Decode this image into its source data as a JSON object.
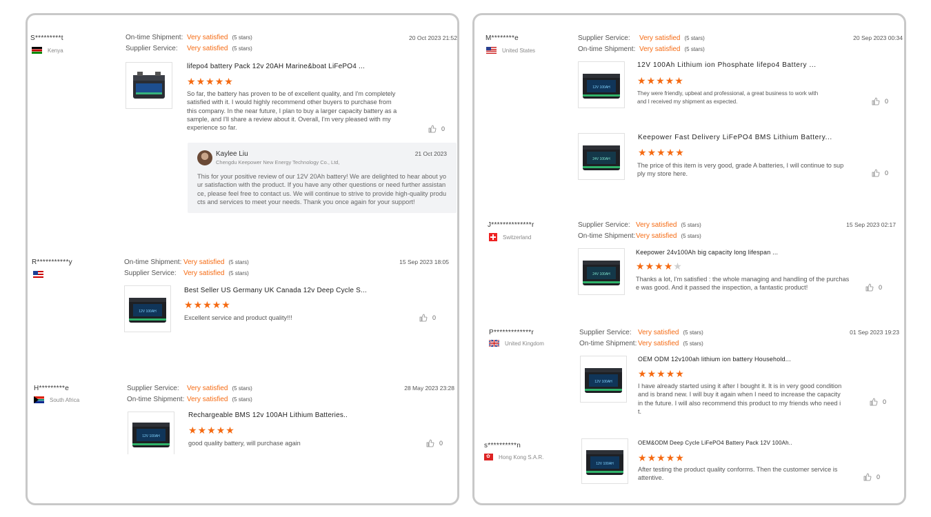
{
  "left": {
    "reviews": [
      {
        "user": "S*********t",
        "country": "Kenya",
        "ratings": [
          {
            "label": "On-time Shipment:",
            "value": "Very satisfied",
            "stars": "(5 stars)"
          },
          {
            "label": "Supplier Service:",
            "value": "Very satisfied",
            "stars": "(5 stars)"
          }
        ],
        "date": "20 Oct 2023 21:52",
        "product": "lifepo4 battery Pack 12v 20AH Marine&boat LiFePO4 ...",
        "rating": 5,
        "text": "So far, the battery has proven to be of excellent quality, and I'm completely satisfied with it. I would highly recommend other buyers to purchase from this company. In the near future, I plan to buy a larger capacity battery as a sample, and I'll share a review about it. Overall, I'm very pleased with my experience so far.",
        "likes": "0",
        "reply": {
          "name": "Kaylee Liu",
          "company": "Chengdu Keepower New Energy Technology Co., Ltd,",
          "date": "21 Oct 2023",
          "text": "This for your positive review of our 12V 20Ah battery! We are delighted to hear about your satisfaction with the product. If you have any other questions or need further assistance, please feel free to contact us. We will continue to strive to provide high-quality products and services to meet your needs. Thank you once again for your support!"
        }
      },
      {
        "user": "R***********y",
        "country": "",
        "ratings": [
          {
            "label": "On-time Shipment:",
            "value": "Very satisfied",
            "stars": "(5 stars)"
          },
          {
            "label": "Supplier Service:",
            "value": "Very satisfied",
            "stars": "(5 stars)"
          }
        ],
        "date": "15 Sep 2023 18:05",
        "product": "Best Seller US Germany UK Canada 12v Deep Cycle S...",
        "rating": 5,
        "text": "Excellent service and product quality!!!",
        "likes": "0"
      },
      {
        "user": "H*********e",
        "country": "South Africa",
        "ratings": [
          {
            "label": "Supplier Service:",
            "value": "Very satisfied",
            "stars": "(5 stars)"
          },
          {
            "label": "On-time Shipment:",
            "value": "Very satisfied",
            "stars": "(5 stars)"
          }
        ],
        "date": "28 May 2023 23:28",
        "product": "Rechargeable BMS 12v 100AH Lithium Batteries..",
        "rating": 5,
        "text": "good quality battery, will purchase again",
        "likes": "0"
      }
    ]
  },
  "right": {
    "reviews": [
      {
        "user": "M********e",
        "country": "United States",
        "ratings": [
          {
            "label": "Supplier Service:",
            "value": "Very satisfied",
            "stars": "(5 stars)"
          },
          {
            "label": "On-time Shipment:",
            "value": "Very satisfied",
            "stars": "(5 stars)"
          }
        ],
        "date": "20 Sep 2023 00:34",
        "items": [
          {
            "product": "12V 100Ah Lithium ion Phosphate lifepo4 Battery ...",
            "rating": 5,
            "text": "They were friendly, upbeat and professional, a great business to work with and I received my shipment as expected.",
            "likes": "0"
          },
          {
            "product": "Keepower Fast Delivery LiFePO4 BMS Lithium Battery...",
            "rating": 5,
            "text": "The price of this item is very good, grade A batteries, I will continue to supply my store here.",
            "likes": "0"
          }
        ]
      },
      {
        "user": "J**************r",
        "country": "Switzerland",
        "ratings": [
          {
            "label": "Supplier Service:",
            "value": "Very satisfied",
            "stars": "(5 stars)"
          },
          {
            "label": "On-time Shipment:",
            "value": "Very satisfied",
            "stars": "(5 stars)"
          }
        ],
        "date": "15 Sep 2023 02:17",
        "product": "Keepower 24v100Ah big capacity long lifespan ...",
        "rating": 4,
        "text": "Thanks a lot, I'm satisfied : the whole managing and handling of the purchase was good.  And it passed the inspection, a fantastic product!",
        "likes": "0"
      },
      {
        "user": "P*************r",
        "country": "United Kingdom",
        "ratings": [
          {
            "label": "Supplier Service:",
            "value": "Very satisfied",
            "stars": "(5 stars)"
          },
          {
            "label": "On-time Shipment:",
            "value": "Very satisfied",
            "stars": "(5 stars)"
          }
        ],
        "date": "01 Sep 2023 19:23",
        "product": "OEM ODM 12v100ah lithium ion battery Household...",
        "rating": 5,
        "text": "I have already started using it after I bought it. It is in very good condition and is brand new. I will buy it again when I need to increase the capacity in the future. I will also recommend this product to my friends who need it.",
        "likes": "0"
      },
      {
        "user": "s**********n",
        "country": "Hong Kong S.A.R.",
        "product": "OEM&ODM Deep Cycle LiFePO4 Battery Pack 12V 100Ah..",
        "rating": 5,
        "text": "After testing the product quality conforms.  Then the customer service is attentive.",
        "likes": "0"
      }
    ]
  },
  "battery_labels": {
    "small": "",
    "big12": "12V 100AH",
    "big24": "24V 100AH"
  },
  "colors": {
    "accent": "#f56a12",
    "border": "#c8c8c8"
  }
}
